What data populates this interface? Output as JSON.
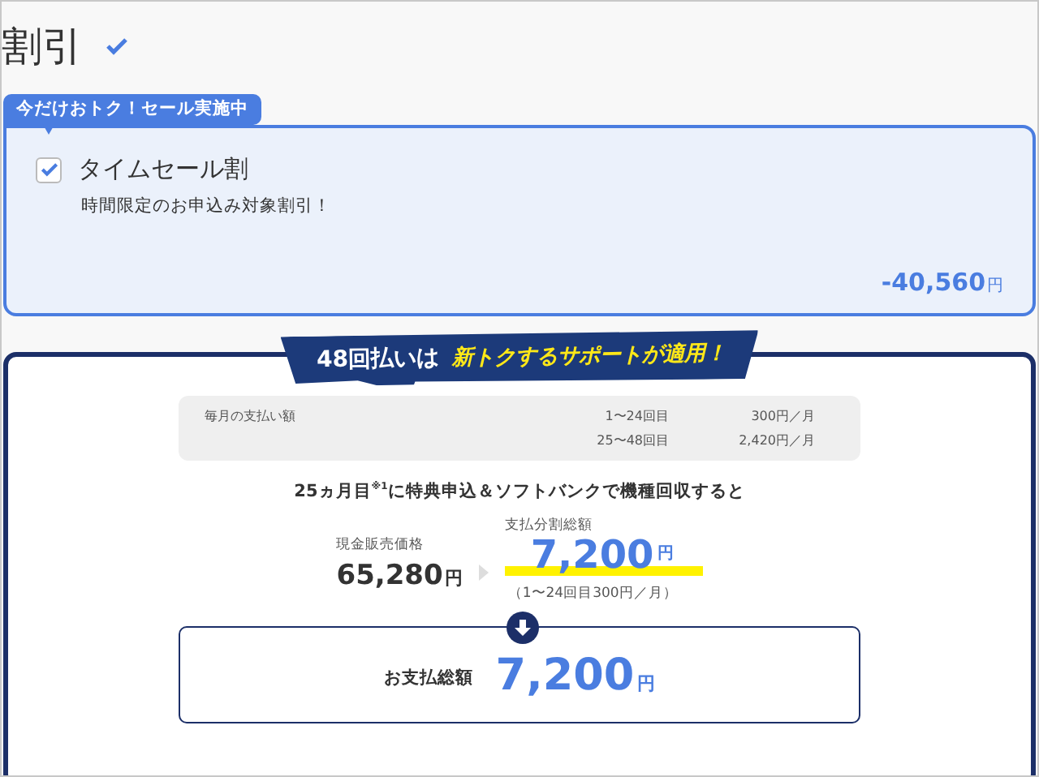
{
  "heading": {
    "title": "割引",
    "checked": true
  },
  "discount": {
    "badge": "今だけおトク！セール実施中",
    "checked": true,
    "name": "タイムセール割",
    "description": "時間限定のお申込み対象割引！",
    "amount": "-40,560",
    "unit": "円"
  },
  "plan": {
    "banner_lead": "48回払いは",
    "banner_highlight": "新トクするサポートが適用！",
    "monthly": {
      "label": "毎月の支払い額",
      "rows": [
        {
          "period": "1〜24回目",
          "price": "300円／月"
        },
        {
          "period": "25〜48回目",
          "price": "2,420円／月"
        }
      ]
    },
    "condition": "25ヵ月目$^{※1}$に特典申込＆ソフトバンクで機種回収すると",
    "cash_label": "現金販売価格",
    "cash_amount": "65,280",
    "cash_unit": "円",
    "installment_label": "支払分割総額",
    "installment_amount": "7,200",
    "installment_unit": "円",
    "installment_note": "（1〜24回目300円／月）",
    "total_label": "お支払総額",
    "total_amount": "7,200",
    "total_unit": "円"
  }
}
